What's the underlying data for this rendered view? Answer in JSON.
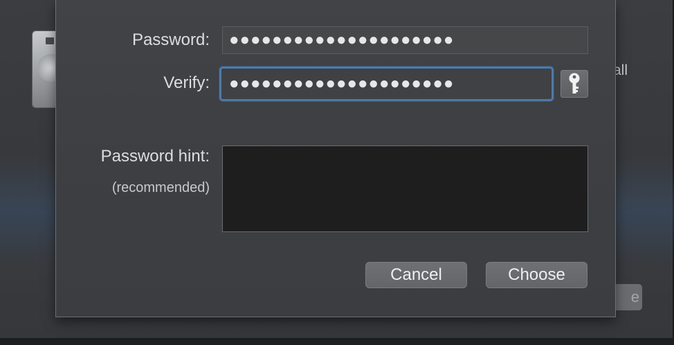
{
  "background_window": {
    "partial_text": "all",
    "partial_button_text": "e"
  },
  "dialog": {
    "password_label": "Password:",
    "password_value": "●●●●●●●●●●●●●●●●●●●●●",
    "verify_label": "Verify:",
    "verify_value": "●●●●●●●●●●●●●●●●●●●●●",
    "key_button_icon": "key-icon",
    "hint_label": "Password hint:",
    "hint_sublabel": "(recommended)",
    "hint_value": "",
    "cancel_label": "Cancel",
    "choose_label": "Choose"
  },
  "colors": {
    "focus_ring": "#4f79a6",
    "sheet_background": "#3f4144",
    "hint_background": "#1e1e1f"
  }
}
